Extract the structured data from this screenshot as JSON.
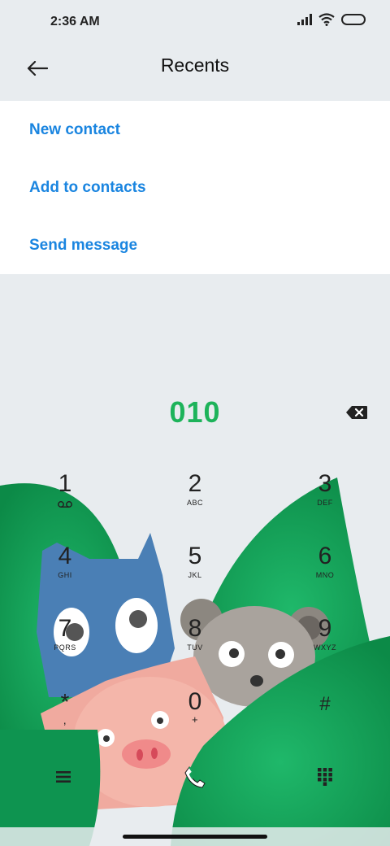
{
  "status_bar": {
    "time": "2:36 AM",
    "icons": [
      "signal-icon",
      "wifi-icon",
      "battery-icon"
    ]
  },
  "header": {
    "title": "Recents",
    "back_icon": "back-arrow-icon"
  },
  "menu": {
    "items": [
      {
        "label": "New contact"
      },
      {
        "label": "Add to contacts"
      },
      {
        "label": "Send message"
      }
    ]
  },
  "dialer": {
    "number": "010",
    "number_color": "#1db35a",
    "delete_icon": "backspace-icon",
    "keys": [
      {
        "digit": "1",
        "letters": ""
      },
      {
        "digit": "2",
        "letters": "ABC"
      },
      {
        "digit": "3",
        "letters": "DEF"
      },
      {
        "digit": "4",
        "letters": "GHI"
      },
      {
        "digit": "5",
        "letters": "JKL"
      },
      {
        "digit": "6",
        "letters": "MNO"
      },
      {
        "digit": "7",
        "letters": "PQRS"
      },
      {
        "digit": "8",
        "letters": "TUV"
      },
      {
        "digit": "9",
        "letters": "WXYZ"
      },
      {
        "digit": "*",
        "letters": ","
      },
      {
        "digit": "0",
        "letters": "+"
      },
      {
        "digit": "#",
        "letters": ""
      }
    ],
    "bottom": [
      "menu-icon",
      "call-icon",
      "dialpad-icon"
    ]
  },
  "colors": {
    "accent": "#1a85e0",
    "leaf_green": "#17a05a",
    "background": "#e8ecef"
  }
}
